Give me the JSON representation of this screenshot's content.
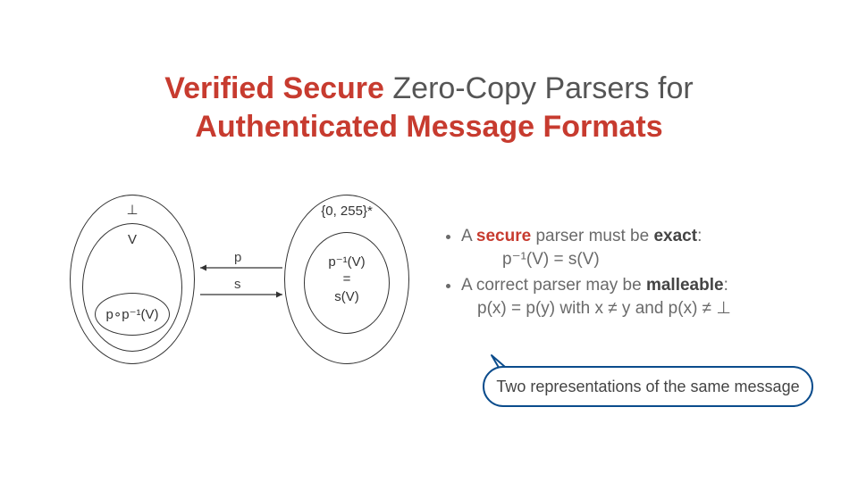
{
  "title": {
    "part1_em": "Verified Secure",
    "part2": " Zero-Copy Parsers for",
    "part3_em": "Authenticated Message Formats"
  },
  "diagram": {
    "leftOuterLabel": "⊥",
    "leftMidLabel": "V",
    "leftInnerLabel": "p∘p⁻¹(V)",
    "rightOuterLabel": "{0, 255}*",
    "rightInnerLine1": "p⁻¹(V)",
    "rightInnerLine2": "=",
    "rightInnerLine3": "s(V)",
    "arrowP": "p",
    "arrowS": "s"
  },
  "bullets": {
    "b1_pre": "A ",
    "b1_secure": "secure",
    "b1_post": " parser must be ",
    "b1_exact": "exact",
    "b1_colon": ":",
    "b1_eq": "p⁻¹(V) = s(V)",
    "b2_pre": "A correct parser may be ",
    "b2_mal": "malleable",
    "b2_colon": ":",
    "b2_eq": "p(x) = p(y) with x ≠ y and p(x) ≠ ⊥"
  },
  "callout": "Two representations of the same message",
  "colors": {
    "accent": "#C73B2F",
    "calloutBorder": "#0B4C8C"
  }
}
